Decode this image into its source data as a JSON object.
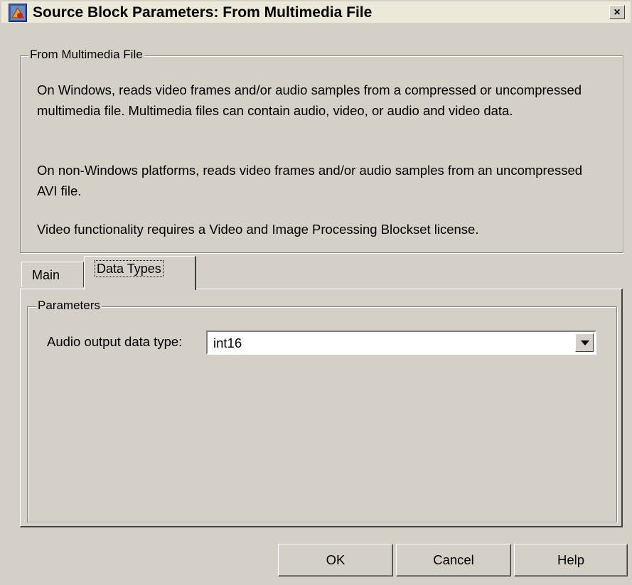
{
  "window": {
    "title": "Source Block Parameters: From Multimedia File",
    "close_label": "×",
    "icon": "simulink-block-icon"
  },
  "description": {
    "group_title": "From Multimedia File",
    "para1": "On Windows, reads video frames and/or audio samples from a compressed or uncompressed multimedia file. Multimedia files can contain audio, video, or audio and video data.",
    "para2": "On non-Windows platforms, reads video frames and/or audio samples from an uncompressed AVI file.",
    "para3": "Video functionality requires a Video and Image Processing Blockset license."
  },
  "tabs": [
    {
      "label": "Main",
      "active": false
    },
    {
      "label": "Data Types",
      "active": true
    }
  ],
  "parameters": {
    "group_title": "Parameters",
    "audio_output_label": "Audio output data type:",
    "audio_output_value": "int16"
  },
  "buttons": {
    "ok": "OK",
    "cancel": "Cancel",
    "help": "Help"
  }
}
